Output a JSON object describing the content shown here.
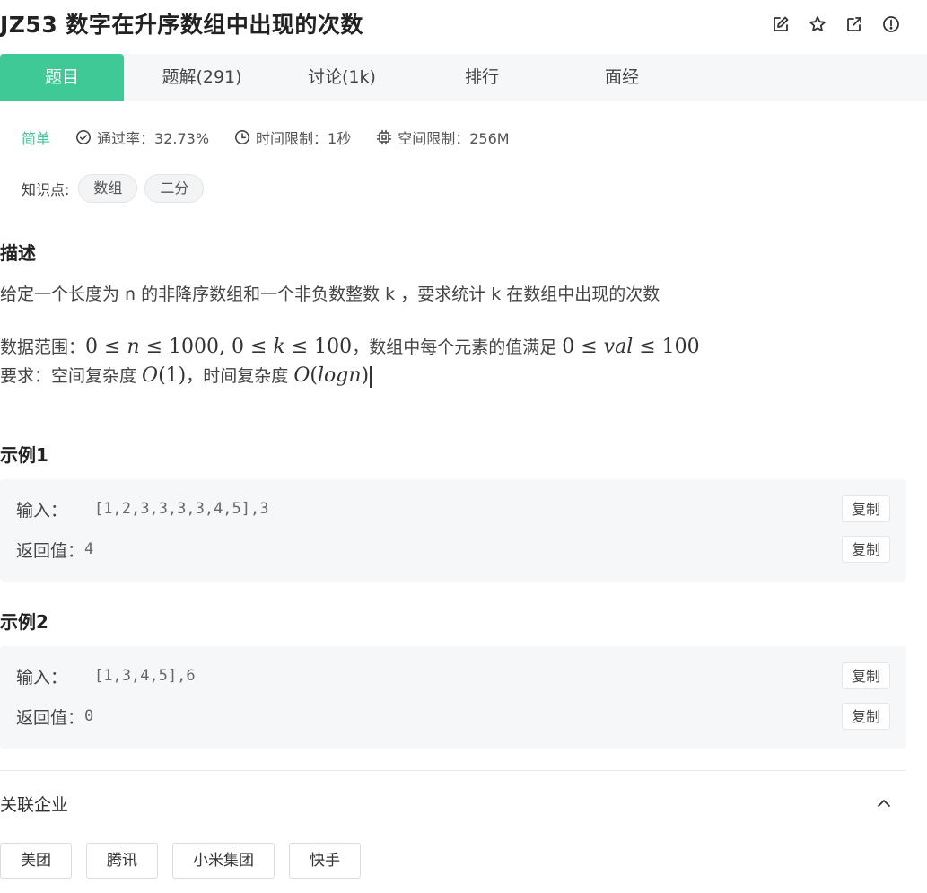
{
  "header": {
    "title": "JZ53  数字在升序数组中出现的次数",
    "icons": [
      "edit-icon",
      "star-icon",
      "external-link-icon",
      "info-icon"
    ]
  },
  "tabs": [
    {
      "label": "题目",
      "active": true
    },
    {
      "label": "题解(291)",
      "active": false
    },
    {
      "label": "讨论(1k)",
      "active": false
    },
    {
      "label": "排行",
      "active": false
    },
    {
      "label": "面经",
      "active": false
    }
  ],
  "meta": {
    "difficulty": "简单",
    "pass_rate": "通过率：32.73%",
    "time_limit": "时间限制：1秒",
    "space_limit": "空间限制：256M"
  },
  "knowledge": {
    "label": "知识点:",
    "tags": [
      "数组",
      "二分"
    ]
  },
  "description": {
    "heading": "描述",
    "text": "给定一个长度为 n 的非降序数组和一个非负数整数 k ，要求统计 k 在数组中出现的次数",
    "range_prefix": "数据范围：",
    "range_sep1": "，数组中每个元素的值满足 ",
    "req_prefix": "要求：空间复杂度 ",
    "req_sep": "，时间复杂度 "
  },
  "examples": [
    {
      "heading": "示例1",
      "input_label": "输入：",
      "input_value": "[1,2,3,3,3,3,4,5],3",
      "output_label": "返回值：",
      "output_value": "4",
      "copy_label": "复制"
    },
    {
      "heading": "示例2",
      "input_label": "输入：",
      "input_value": "[1,3,4,5],6",
      "output_label": "返回值：",
      "output_value": "0",
      "copy_label": "复制"
    }
  ],
  "companies": {
    "heading": "关联企业",
    "items": [
      "美团",
      "腾讯",
      "小米集团",
      "快手"
    ]
  },
  "colors": {
    "accent": "#3ec997",
    "tab_bg": "#f6f7f9",
    "text": "#333333"
  }
}
